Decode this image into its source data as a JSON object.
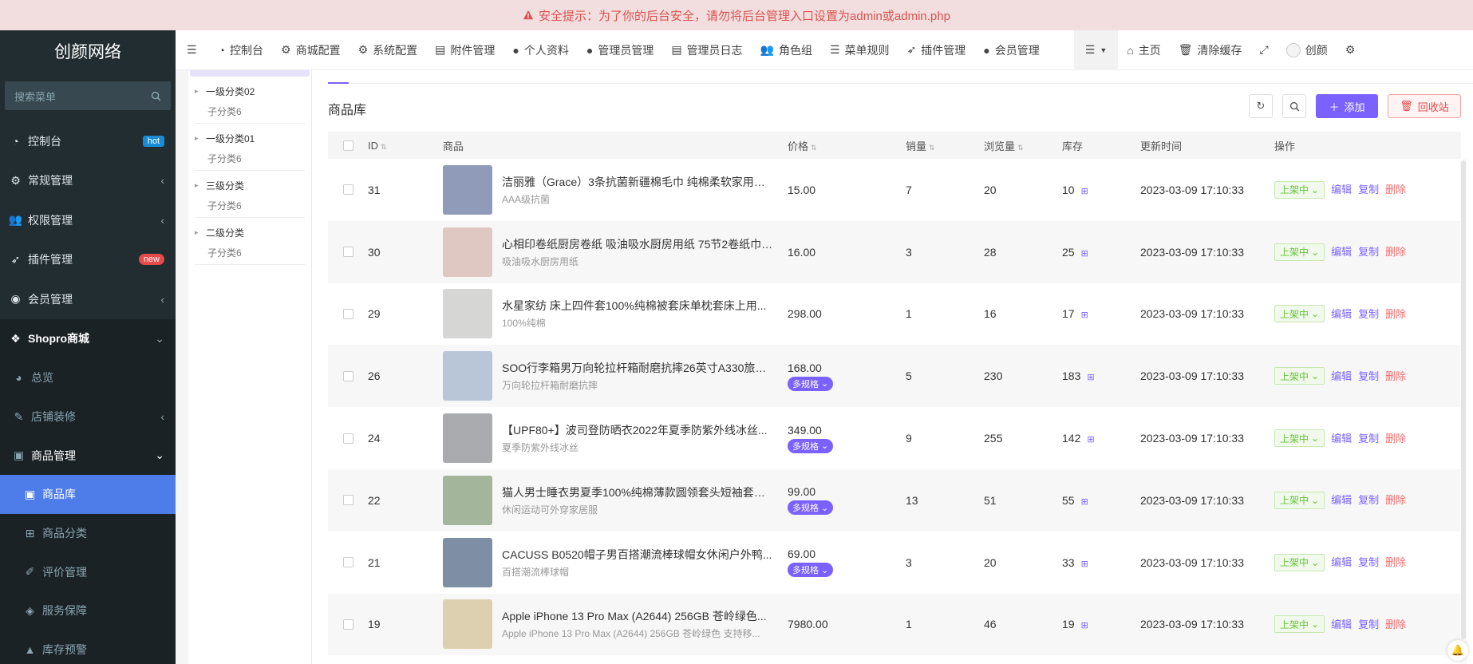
{
  "alert": {
    "text": "安全提示：为了你的后台安全，请勿将后台管理入口设置为admin或admin.php"
  },
  "sidebar": {
    "logo": "创颜网络",
    "search_placeholder": "搜索菜单",
    "items": [
      {
        "label": "控制台",
        "badge": "hot"
      },
      {
        "label": "常规管理",
        "arrow": "‹"
      },
      {
        "label": "权限管理",
        "arrow": "‹"
      },
      {
        "label": "插件管理",
        "badge": "new"
      },
      {
        "label": "会员管理",
        "arrow": "‹"
      },
      {
        "label": "Shopro商城",
        "arrow": "⌄"
      },
      {
        "label": "总览"
      },
      {
        "label": "店铺装修",
        "arrow": "‹"
      },
      {
        "label": "商品管理",
        "arrow": "⌄"
      },
      {
        "label": "商品库"
      },
      {
        "label": "商品分类"
      },
      {
        "label": "评价管理"
      },
      {
        "label": "服务保障"
      },
      {
        "label": "库存预警"
      }
    ]
  },
  "topnav": {
    "items": [
      "控制台",
      "商城配置",
      "系统配置",
      "附件管理",
      "个人资料",
      "管理员管理",
      "管理员日志",
      "角色组",
      "菜单规则",
      "插件管理",
      "会员管理"
    ],
    "right": {
      "home": "主页",
      "clear_cache": "清除缓存",
      "user": "创颜"
    }
  },
  "tree": [
    {
      "title": "一级分类02",
      "child": "子分类6"
    },
    {
      "title": "一级分类01",
      "child": "子分类6"
    },
    {
      "title": "三级分类",
      "child": "子分类6"
    },
    {
      "title": "二级分类",
      "child": "子分类6"
    }
  ],
  "page": {
    "title": "商品库",
    "add_label": "添加",
    "recycle_label": "回收站"
  },
  "table": {
    "headers": {
      "id": "ID",
      "goods": "商品",
      "price": "价格",
      "sales": "销量",
      "views": "浏览量",
      "stock": "库存",
      "time": "更新时间",
      "ops": "操作"
    },
    "status_label": "上架中",
    "spec_label": "多规格",
    "op_edit": "编辑",
    "op_copy": "复制",
    "op_delete": "删除",
    "rows": [
      {
        "id": "31",
        "title": "洁丽雅（Grace）3条抗菌新疆棉毛巾 纯棉柔软家用洗...",
        "sub": "AAA级抗菌",
        "price": "15.00",
        "multi": false,
        "sales": "7",
        "views": "20",
        "stock": "10",
        "time": "2023-03-09 17:10:33",
        "thumb_color": "#8f9bb8"
      },
      {
        "id": "30",
        "title": "心相印卷纸厨房卷纸 吸油吸水厨房用纸 75节2卷纸巾 ...",
        "sub": "吸油吸水厨房用纸",
        "price": "16.00",
        "multi": false,
        "sales": "3",
        "views": "28",
        "stock": "25",
        "time": "2023-03-09 17:10:33",
        "thumb_color": "#e0c8c2"
      },
      {
        "id": "29",
        "title": "水星家纺 床上四件套100%纯棉被套床单枕套床上用...",
        "sub": "100%纯棉",
        "price": "298.00",
        "multi": false,
        "sales": "1",
        "views": "16",
        "stock": "17",
        "time": "2023-03-09 17:10:33",
        "thumb_color": "#d6d6d4"
      },
      {
        "id": "26",
        "title": "SOO行李箱男万向轮拉杆箱耐磨抗摔26英寸A330旅行...",
        "sub": "万向轮拉杆箱耐磨抗摔",
        "price": "168.00",
        "multi": true,
        "sales": "5",
        "views": "230",
        "stock": "183",
        "time": "2023-03-09 17:10:33",
        "thumb_color": "#b9c6d8"
      },
      {
        "id": "24",
        "title": "【UPF80+】波司登防晒衣2022年夏季防紫外线冰丝...",
        "sub": "夏季防紫外线冰丝",
        "price": "349.00",
        "multi": true,
        "sales": "9",
        "views": "255",
        "stock": "142",
        "time": "2023-03-09 17:10:33",
        "thumb_color": "#a9abaf"
      },
      {
        "id": "22",
        "title": "猫人男士睡衣男夏季100%纯棉薄款圆领套头短袖套装...",
        "sub": "休闲运动可外穿家居服",
        "price": "99.00",
        "multi": true,
        "sales": "13",
        "views": "51",
        "stock": "55",
        "time": "2023-03-09 17:10:33",
        "thumb_color": "#a3b69c"
      },
      {
        "id": "21",
        "title": "CACUSS B0520帽子男百搭潮流棒球帽女休闲户外鸭...",
        "sub": "百搭潮流棒球帽",
        "price": "69.00",
        "multi": true,
        "sales": "3",
        "views": "20",
        "stock": "33",
        "time": "2023-03-09 17:10:33",
        "thumb_color": "#7e8ea5"
      },
      {
        "id": "19",
        "title": "Apple iPhone 13 Pro Max (A2644) 256GB 苍岭绿色...",
        "sub": "Apple iPhone 13 Pro Max (A2644) 256GB 苍岭绿色 支持移...",
        "price": "7980.00",
        "multi": false,
        "sales": "1",
        "views": "46",
        "stock": "19",
        "time": "2023-03-09 17:10:33",
        "thumb_color": "#ddd0b0"
      }
    ]
  },
  "colors": {
    "accent": "#7b61ff",
    "sidebar_bg": "#222d32",
    "active": "#4e7dea",
    "danger": "#e64a4a",
    "success": "#67c23a"
  }
}
